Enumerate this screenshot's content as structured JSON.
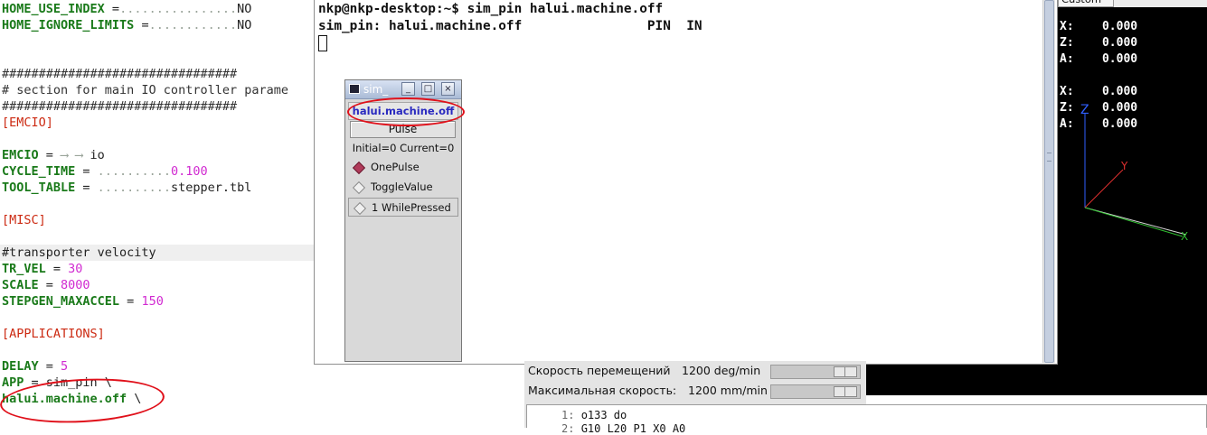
{
  "editor": {
    "lines": {
      "home_use_index_key": "HOME_USE_INDEX",
      "home_use_index_sep": " =",
      "home_use_index_dots": "................",
      "home_use_index_val": "NO",
      "home_ignore_limits_key": "HOME_IGNORE_LIMITS",
      "home_ignore_limits_sep": " =",
      "home_ignore_limits_dots": "............",
      "home_ignore_limits_val": "NO",
      "hash_line_1": "################################",
      "section_comment": "# section for main IO controller parame",
      "hash_line_2": "################################",
      "emcio_section": "[EMCIO]",
      "emcio_key": "EMCIO",
      "emcio_sep": " = ",
      "emcio_arrows": "⟶ ⟶ ",
      "emcio_val": "io",
      "cycle_time_key": "CYCLE_TIME",
      "cycle_time_sep": " = ",
      "cycle_time_dots": "..........",
      "cycle_time_val": "0.100",
      "tool_table_key": "TOOL_TABLE",
      "tool_table_sep": " = ",
      "tool_table_dots": "..........",
      "tool_table_val": "stepper.tbl",
      "misc_section": "[MISC]",
      "transporter_comment": "#transporter velocity",
      "tr_vel_key": "TR_VEL",
      "tr_vel_sep": " = ",
      "tr_vel_val": "30",
      "scale_key": "SCALE",
      "scale_sep": " = ",
      "scale_val": "8000",
      "stepgen_key": "STEPGEN_MAXACCEL",
      "stepgen_sep": " = ",
      "stepgen_val": "150",
      "applications_section": "[APPLICATIONS]",
      "delay_key": "DELAY",
      "delay_sep": " = ",
      "delay_val": "5",
      "app_key": "APP",
      "app_sep": " = ",
      "app_val": "sim_pin \\",
      "halui_line": "halui.machine.off",
      "halui_tail": " \\"
    }
  },
  "terminal": {
    "prompt_line": "nkp@nkp-desktop:~$ sim_pin halui.machine.off",
    "output_line": "sim_pin: halui.machine.off                PIN  IN"
  },
  "sim_pin_window": {
    "title": "sim_",
    "pin_name": "halui.machine.off",
    "pulse_button": "Pulse",
    "status": "Initial=0 Current=0",
    "options": [
      {
        "label": "OnePulse",
        "selected": true
      },
      {
        "label": "ToggleValue",
        "selected": false
      },
      {
        "label": "1 WhilePressed",
        "selected": false
      }
    ]
  },
  "view3d": {
    "tab_label": "Custom",
    "dro_group_1": [
      {
        "axis": "X:",
        "value": "0.000"
      },
      {
        "axis": "Z:",
        "value": "0.000"
      },
      {
        "axis": "A:",
        "value": "0.000"
      }
    ],
    "dro_group_2": [
      {
        "axis": "X:",
        "value": "0.000"
      },
      {
        "axis": "Z:",
        "value": "0.000"
      },
      {
        "axis": "A:",
        "value": "0.000"
      }
    ],
    "colors": {
      "x_axis": "#e03030",
      "y_axis": "#30c030",
      "z_axis": "#3060ff",
      "background": "#000000"
    }
  },
  "control_panel": {
    "jog_speed_label": "Скорость перемещений",
    "jog_speed_value": "1200 deg/min",
    "max_speed_label": "Максимальная скорость:",
    "max_speed_value": "1200 mm/min"
  },
  "gcode": {
    "lines": [
      {
        "num": "1:",
        "text": "o133 do"
      },
      {
        "num": "2:",
        "text": "G10 L20 P1 X0 A0"
      }
    ]
  }
}
